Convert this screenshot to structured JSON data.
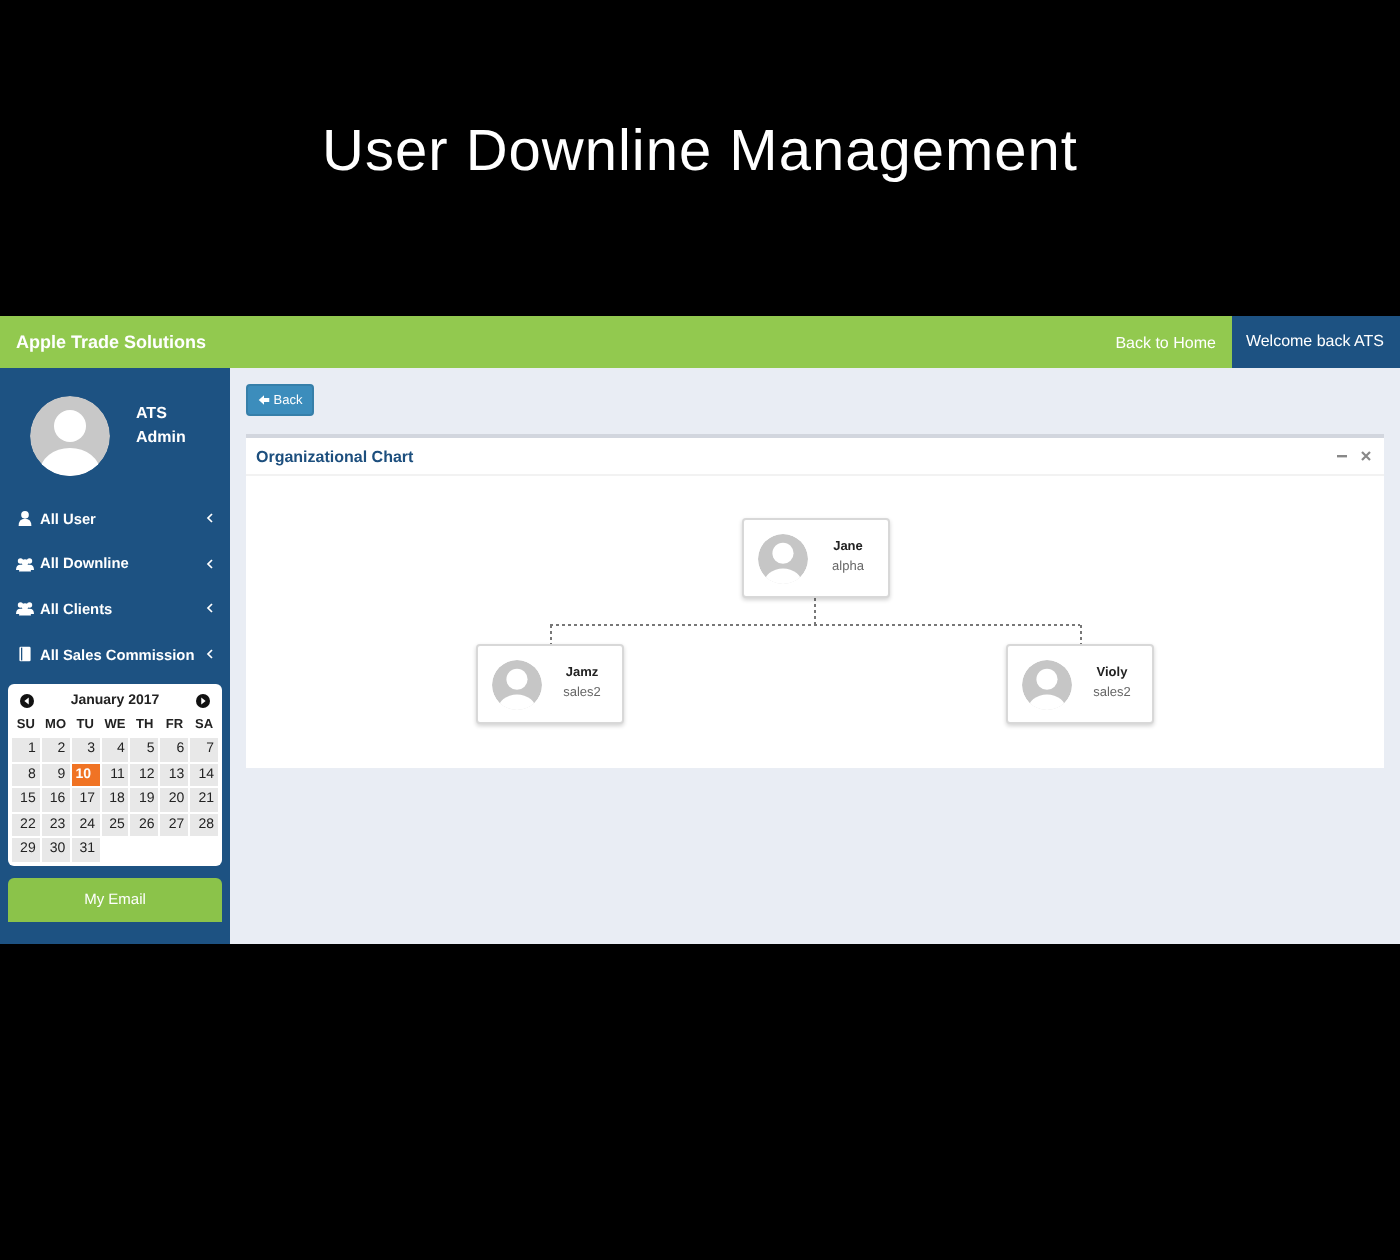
{
  "page_title": "User Downline Management",
  "header": {
    "brand": "Apple Trade Solutions",
    "links": [
      {
        "label": "Back to Home",
        "kind": "link"
      },
      {
        "label": "Welcome back ATS",
        "kind": "user"
      }
    ]
  },
  "sidebar": {
    "user": {
      "name": "ATS",
      "role": "Admin"
    },
    "menu": [
      {
        "label": "All User",
        "kind": "user"
      },
      {
        "label": "All Downline",
        "kind": "group"
      },
      {
        "label": "All Clients",
        "kind": "group"
      },
      {
        "label": "All Sales Commission",
        "kind": "book"
      }
    ],
    "calendar": {
      "month": "January 2017",
      "weekdays": [
        "SU",
        "MO",
        "TU",
        "WE",
        "TH",
        "FR",
        "SA"
      ],
      "days": [
        {
          "label": "1",
          "selected": false
        },
        {
          "label": "2",
          "selected": false
        },
        {
          "label": "3",
          "selected": false
        },
        {
          "label": "4",
          "selected": false
        },
        {
          "label": "5",
          "selected": false
        },
        {
          "label": "6",
          "selected": false
        },
        {
          "label": "7",
          "selected": false
        },
        {
          "label": "8",
          "selected": false
        },
        {
          "label": "9",
          "selected": false
        },
        {
          "label": "10",
          "selected": true
        },
        {
          "label": "11",
          "selected": false
        },
        {
          "label": "12",
          "selected": false
        },
        {
          "label": "13",
          "selected": false
        },
        {
          "label": "14",
          "selected": false
        },
        {
          "label": "15",
          "selected": false
        },
        {
          "label": "16",
          "selected": false
        },
        {
          "label": "17",
          "selected": false
        },
        {
          "label": "18",
          "selected": false
        },
        {
          "label": "19",
          "selected": false
        },
        {
          "label": "20",
          "selected": false
        },
        {
          "label": "21",
          "selected": false
        },
        {
          "label": "22",
          "selected": false
        },
        {
          "label": "23",
          "selected": false
        },
        {
          "label": "24",
          "selected": false
        },
        {
          "label": "25",
          "selected": false
        },
        {
          "label": "26",
          "selected": false
        },
        {
          "label": "27",
          "selected": false
        },
        {
          "label": "28",
          "selected": false
        },
        {
          "label": "29",
          "selected": false
        },
        {
          "label": "30",
          "selected": false
        },
        {
          "label": "31",
          "selected": false
        }
      ]
    },
    "email_button": "My Email"
  },
  "content": {
    "back_button": "Back",
    "panel": {
      "title": "Organizational Chart",
      "org_chart": {
        "name": "Jane",
        "role": "alpha",
        "children": [
          {
            "name": "Jamz",
            "role": "sales2"
          },
          {
            "name": "Violy",
            "role": "sales2"
          }
        ]
      }
    }
  }
}
